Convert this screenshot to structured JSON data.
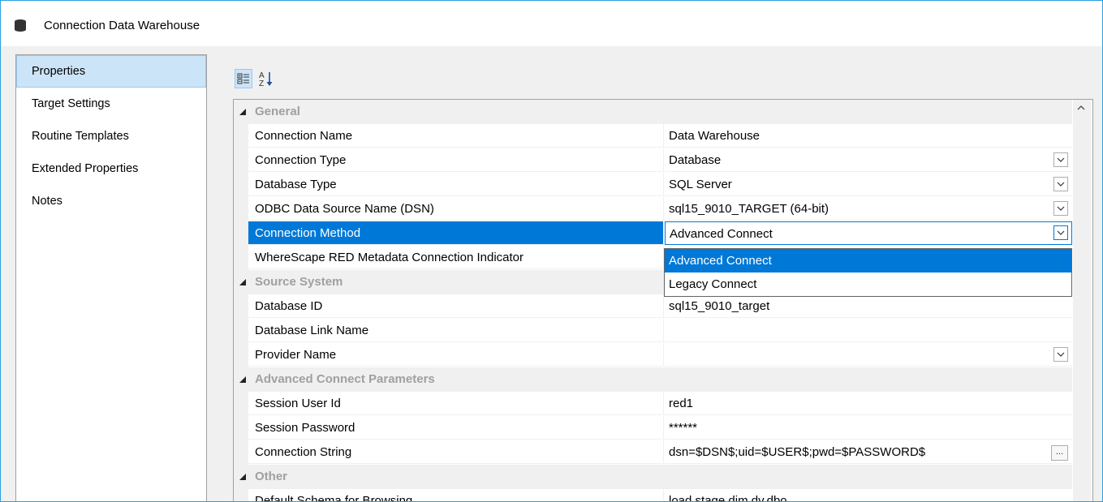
{
  "window": {
    "title": "Connection Data Warehouse",
    "icon": "database-icon"
  },
  "nav": {
    "items": [
      {
        "label": "Properties",
        "active": true
      },
      {
        "label": "Target Settings"
      },
      {
        "label": "Routine Templates"
      },
      {
        "label": "Extended Properties"
      },
      {
        "label": "Notes"
      }
    ]
  },
  "toolbar": {
    "categorized_icon": "categorized-icon",
    "alphabetical_icon": "sort-alphabetical-icon"
  },
  "grid": {
    "categories": {
      "general": "General",
      "source_system": "Source System",
      "advanced": "Advanced Connect Parameters",
      "other": "Other"
    },
    "rows": {
      "connection_name": {
        "name": "Connection Name",
        "value": "Data Warehouse"
      },
      "connection_type": {
        "name": "Connection Type",
        "value": "Database"
      },
      "database_type": {
        "name": "Database Type",
        "value": "SQL Server"
      },
      "odbc_dsn": {
        "name": "ODBC Data Source Name (DSN)",
        "value": "sql15_9010_TARGET (64-bit)"
      },
      "connection_method": {
        "name": "Connection Method",
        "value": "Advanced Connect"
      },
      "metadata_indicator": {
        "name": "WhereScape RED Metadata Connection Indicator",
        "value": ""
      },
      "database_id": {
        "name": "Database ID",
        "value": "sql15_9010_target"
      },
      "database_link_name": {
        "name": "Database Link Name",
        "value": ""
      },
      "provider_name": {
        "name": "Provider Name",
        "value": ""
      },
      "session_user_id": {
        "name": "Session User Id",
        "value": "red1"
      },
      "session_password": {
        "name": "Session Password",
        "value": "******"
      },
      "connection_string": {
        "name": "Connection String",
        "value": "dsn=$DSN$;uid=$USER$;pwd=$PASSWORD$"
      },
      "default_schema": {
        "name": "Default Schema for Browsing",
        "value": "load,stage,dim,dv,dbo"
      }
    },
    "dropdown_options": [
      "Advanced Connect",
      "Legacy Connect"
    ],
    "ellipsis_label": "..."
  },
  "colors": {
    "accent": "#0078d7",
    "category_text": "#a0a0a0"
  }
}
